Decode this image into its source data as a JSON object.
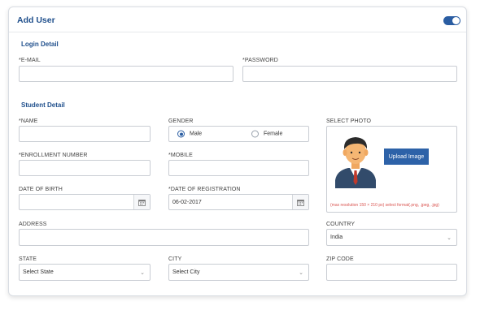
{
  "header": {
    "title": "Add User"
  },
  "login": {
    "section_title": "Login Detail",
    "email_label": "*E-MAIL",
    "email_value": "",
    "password_label": "*PASSWORD",
    "password_value": ""
  },
  "student": {
    "section_title": "Student Detail",
    "name_label": "*NAME",
    "name_value": "",
    "gender_label": "GENDER",
    "gender_options": [
      "Male",
      "Female"
    ],
    "gender_selected": "Male",
    "photo_label": "SELECT PHOTO",
    "upload_label": "Upload Image",
    "photo_hint": "(max resolution 150 × 210 px) select format(.png, .jpeg, .jpg)",
    "enrollment_label": "*ENROLLMENT NUMBER",
    "enrollment_value": "",
    "mobile_label": "*MOBILE",
    "mobile_value": "",
    "dob_label": "DATE OF BIRTH",
    "dob_value": "",
    "registration_label": "*DATE OF REGISTRATION",
    "registration_value": "06-02-2017",
    "address_label": "ADDRESS",
    "address_value": "",
    "country_label": "COUNTRY",
    "country_value": "India",
    "state_label": "STATE",
    "state_value": "Select State",
    "city_label": "CITY",
    "city_value": "Select City",
    "zip_label": "ZIP CODE",
    "zip_value": ""
  },
  "colors": {
    "accent": "#1f4f8c",
    "button": "#2d62a8",
    "hint": "#d9534f",
    "border": "#c9cdd3"
  },
  "icons": [
    "calendar-icon",
    "chevron-down-icon",
    "user-avatar-icon"
  ]
}
